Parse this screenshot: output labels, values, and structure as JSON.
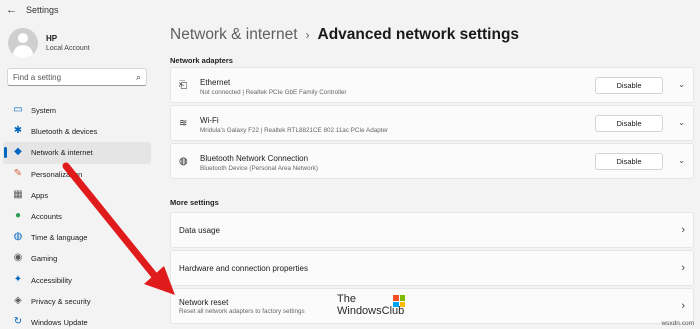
{
  "app": {
    "title": "Settings",
    "back_glyph": "←"
  },
  "user": {
    "name": "HP",
    "account_type": "Local Account"
  },
  "search": {
    "placeholder": "Find a setting"
  },
  "nav": [
    {
      "label": "System",
      "icon": "monitor-icon",
      "glyph": "▭",
      "color": "#0067c0",
      "active": false
    },
    {
      "label": "Bluetooth & devices",
      "icon": "bluetooth-icon",
      "glyph": "✱",
      "color": "#0067c0",
      "active": false
    },
    {
      "label": "Network & internet",
      "icon": "wifi-icon",
      "glyph": "◆",
      "color": "#0067c0",
      "active": true
    },
    {
      "label": "Personalization",
      "icon": "brush-icon",
      "glyph": "✎",
      "color": "#d8613c",
      "active": false
    },
    {
      "label": "Apps",
      "icon": "apps-icon",
      "glyph": "▦",
      "color": "#5a5a5a",
      "active": false
    },
    {
      "label": "Accounts",
      "icon": "person-icon",
      "glyph": "●",
      "color": "#2e9c57",
      "active": false
    },
    {
      "label": "Time & language",
      "icon": "globe-icon",
      "glyph": "◍",
      "color": "#0067c0",
      "active": false
    },
    {
      "label": "Gaming",
      "icon": "controller-icon",
      "glyph": "◉",
      "color": "#5a5a5a",
      "active": false
    },
    {
      "label": "Accessibility",
      "icon": "accessibility-icon",
      "glyph": "✦",
      "color": "#0067c0",
      "active": false
    },
    {
      "label": "Privacy & security",
      "icon": "shield-icon",
      "glyph": "◈",
      "color": "#5a5a5a",
      "active": false
    },
    {
      "label": "Windows Update",
      "icon": "update-icon",
      "glyph": "↻",
      "color": "#0067c0",
      "active": false
    }
  ],
  "breadcrumb": {
    "parent": "Network & internet",
    "separator": "›",
    "current": "Advanced network settings"
  },
  "network_adapters": {
    "heading": "Network adapters",
    "items": [
      {
        "title": "Ethernet",
        "subtitle": "Not connected | Realtek PCIe GbE Family Controller",
        "button": "Disable",
        "icon": "ethernet-icon",
        "glyph": "⎗"
      },
      {
        "title": "Wi-Fi",
        "subtitle": "Mridula's Galaxy F22 | Realtek RTL8821CE 802.11ac PCIe Adapter",
        "button": "Disable",
        "icon": "wifi-icon",
        "glyph": "≋"
      },
      {
        "title": "Bluetooth Network Connection",
        "subtitle": "Bluetooth Device (Personal Area Network)",
        "button": "Disable",
        "icon": "globe-icon",
        "glyph": "◍"
      }
    ]
  },
  "more_settings": {
    "heading": "More settings",
    "items": [
      {
        "title": "Data usage"
      },
      {
        "title": "Hardware and connection properties"
      },
      {
        "title": "Network reset",
        "subtitle": "Reset all network adapters to factory settings"
      }
    ]
  },
  "chevron": {
    "down": "⌄",
    "right": "›"
  },
  "watermark": {
    "line1": "The",
    "line2": "WindowsClub"
  },
  "credit": "wsxdn.com",
  "colors": {
    "accent": "#0067c0",
    "arrow": "#e01b1b"
  }
}
